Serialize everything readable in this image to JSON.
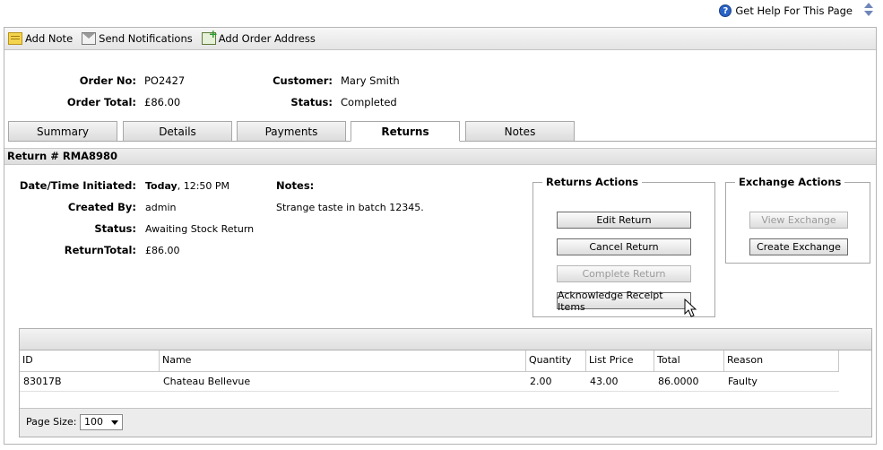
{
  "help": {
    "label": "Get Help For This Page"
  },
  "toolbar": {
    "add_note": "Add Note",
    "send_notifications": "Send Notifications",
    "add_order_address": "Add Order Address"
  },
  "order": {
    "order_no_label": "Order No:",
    "order_no": "PO2427",
    "order_total_label": "Order Total:",
    "order_total": "£86.00",
    "customer_label": "Customer:",
    "customer": "Mary Smith",
    "status_label": "Status:",
    "status": "Completed"
  },
  "tabs": [
    {
      "label": "Summary"
    },
    {
      "label": "Details"
    },
    {
      "label": "Payments"
    },
    {
      "label": "Returns",
      "active": true
    },
    {
      "label": "Notes"
    }
  ],
  "return": {
    "header": "Return # RMA8980",
    "initiated_label": "Date/Time Initiated:",
    "initiated_day": "Today",
    "initiated_time": ", 12:50 PM",
    "created_by_label": "Created By:",
    "created_by": "admin",
    "status_label": "Status:",
    "status": "Awaiting Stock Return",
    "total_label": "ReturnTotal:",
    "total": "£86.00",
    "notes_label": "Notes:",
    "notes": "Strange taste in batch 12345."
  },
  "returns_actions": {
    "legend": "Returns Actions",
    "edit": "Edit Return",
    "cancel": "Cancel Return",
    "complete": "Complete Return",
    "acknowledge": "Acknowledge Receipt Items"
  },
  "exchange_actions": {
    "legend": "Exchange Actions",
    "view": "View Exchange",
    "create": "Create Exchange"
  },
  "grid": {
    "columns": [
      "ID",
      "Name",
      "Quantity",
      "List Price",
      "Total",
      "Reason"
    ],
    "rows": [
      [
        "83017B",
        "Chateau Bellevue",
        "2.00",
        "43.00",
        "86.0000",
        "Faulty"
      ]
    ],
    "page_size_label": "Page Size:",
    "page_size": "100"
  }
}
